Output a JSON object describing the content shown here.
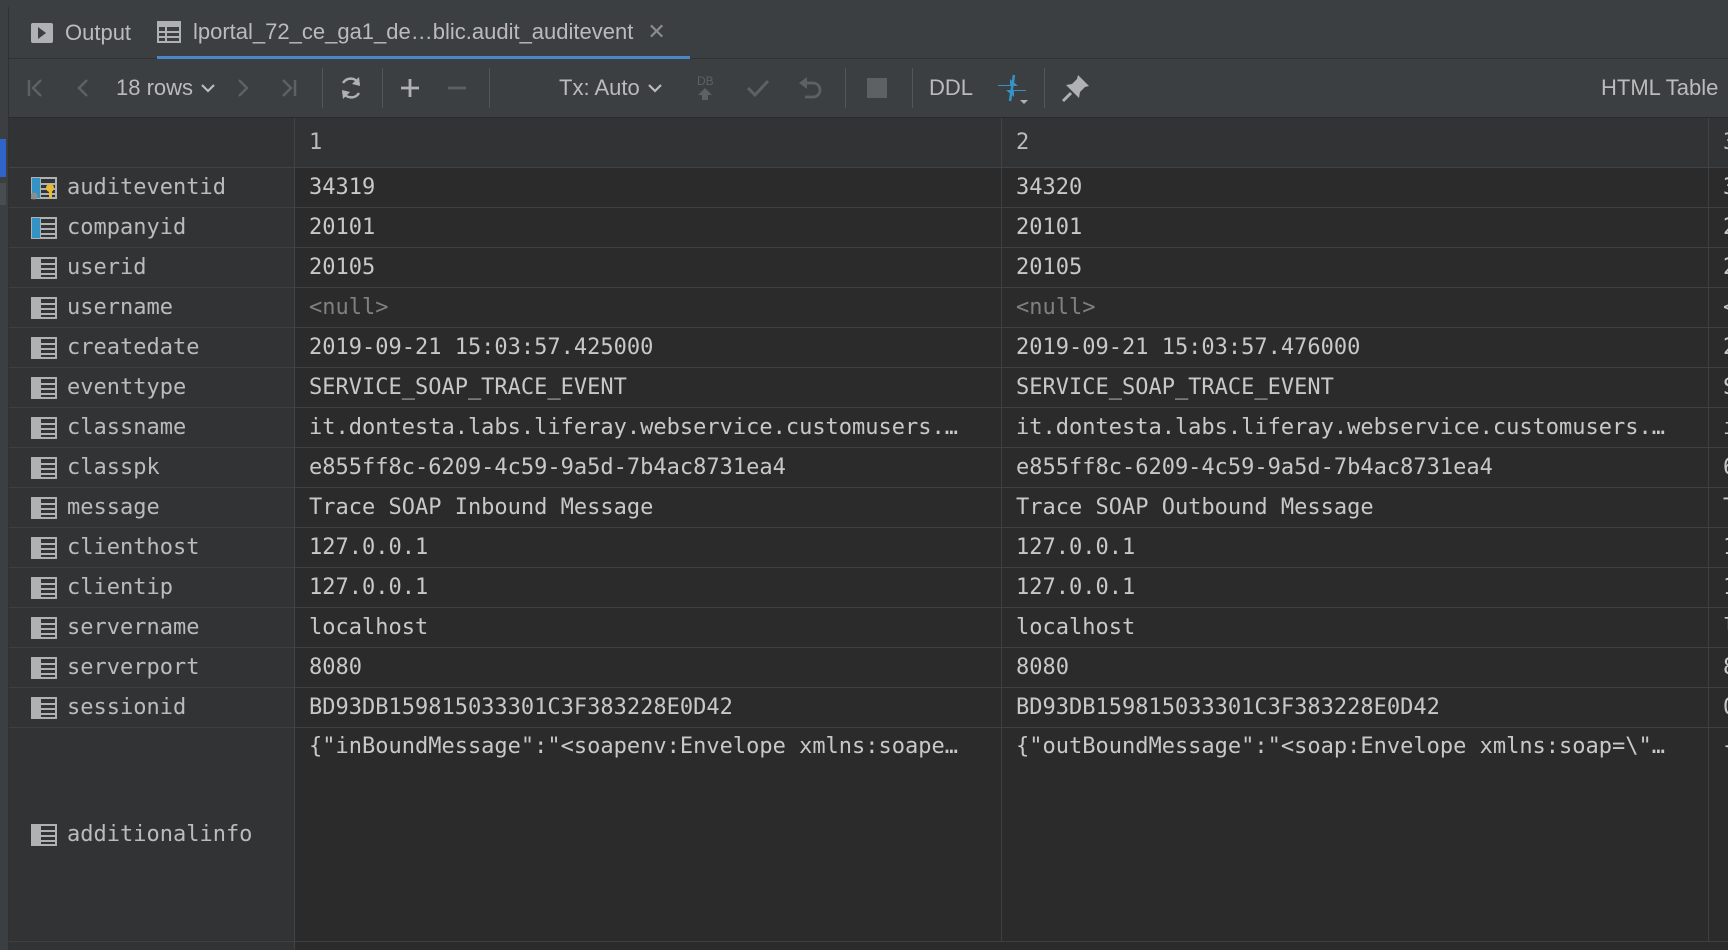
{
  "tabs": [
    {
      "label": "Output",
      "icon": "console-run-icon",
      "active": false
    },
    {
      "label": "lportal_72_ce_ga1_de…blic.audit_auditevent",
      "icon": "table-icon",
      "active": true
    }
  ],
  "toolbar": {
    "rows_label": "18 rows",
    "tx_label": "Tx: Auto",
    "db_label": "DB",
    "ddl_label": "DDL",
    "view_mode_label": "HTML Table"
  },
  "grid": {
    "columns": [
      "1",
      "2",
      "3"
    ],
    "rows": [
      {
        "field": "auditeventid",
        "icon": "primary-key-column-icon",
        "values": [
          "34319",
          "34320",
          "3"
        ]
      },
      {
        "field": "companyid",
        "icon": "indexed-column-icon",
        "values": [
          "20101",
          "20101",
          "2"
        ]
      },
      {
        "field": "userid",
        "icon": "column-icon",
        "values": [
          "20105",
          "20105",
          "2"
        ]
      },
      {
        "field": "username",
        "icon": "column-icon",
        "values": [
          "<null>",
          "<null>",
          "<"
        ]
      },
      {
        "field": "createdate",
        "icon": "column-icon",
        "values": [
          "2019-09-21 15:03:57.425000",
          "2019-09-21 15:03:57.476000",
          "2"
        ]
      },
      {
        "field": "eventtype",
        "icon": "column-icon",
        "values": [
          "SERVICE_SOAP_TRACE_EVENT",
          "SERVICE_SOAP_TRACE_EVENT",
          "S"
        ]
      },
      {
        "field": "classname",
        "icon": "column-icon",
        "values": [
          "it.dontesta.labs.liferay.webservice.customusers.…",
          "it.dontesta.labs.liferay.webservice.customusers.…",
          "i"
        ]
      },
      {
        "field": "classpk",
        "icon": "column-icon",
        "values": [
          "e855ff8c-6209-4c59-9a5d-7b4ac8731ea4",
          "e855ff8c-6209-4c59-9a5d-7b4ac8731ea4",
          "6"
        ]
      },
      {
        "field": "message",
        "icon": "column-icon",
        "values": [
          "Trace SOAP Inbound Message",
          "Trace SOAP Outbound Message",
          "T"
        ]
      },
      {
        "field": "clienthost",
        "icon": "column-icon",
        "values": [
          "127.0.0.1",
          "127.0.0.1",
          "1"
        ]
      },
      {
        "field": "clientip",
        "icon": "column-icon",
        "values": [
          "127.0.0.1",
          "127.0.0.1",
          "1"
        ]
      },
      {
        "field": "servername",
        "icon": "column-icon",
        "values": [
          "localhost",
          "localhost",
          "l"
        ]
      },
      {
        "field": "serverport",
        "icon": "column-icon",
        "values": [
          "8080",
          "8080",
          "8"
        ]
      },
      {
        "field": "sessionid",
        "icon": "column-icon",
        "values": [
          "BD93DB159815033301C3F383228E0D42",
          "BD93DB159815033301C3F383228E0D42",
          "0"
        ]
      },
      {
        "field": "additionalinfo",
        "icon": "column-icon",
        "values": [
          "{\"inBoundMessage\":\"<soapenv:Envelope xmlns:soape…",
          "{\"outBoundMessage\":\"<soap:Envelope xmlns:soap=\\\"…",
          "{"
        ]
      }
    ]
  }
}
